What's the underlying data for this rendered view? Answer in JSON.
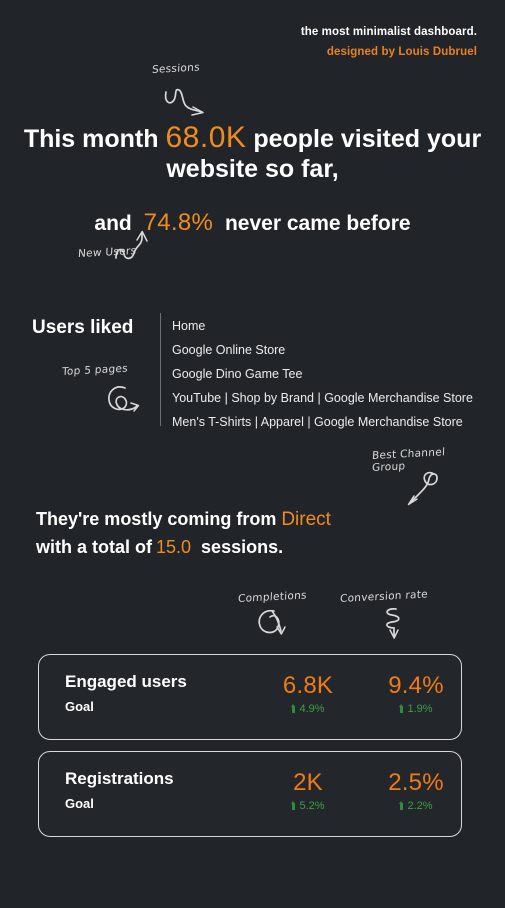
{
  "header": {
    "title": "the most minimalist dashboard.",
    "designer": "designed by Louis Dubruel",
    "accent_color": "#e8821e"
  },
  "theme": {
    "background": "#212529",
    "text": "#ffffff",
    "accent_orange": "#f08c1e",
    "metric_orange": "#ef7b14",
    "positive_green": "#3d9e46",
    "divider": "#6d7074"
  },
  "annotations": {
    "sessions": "Sessions",
    "new_users": "New Users",
    "top_pages": "Top 5 pages",
    "best_channel_group_line1": "Best Channel",
    "best_channel_group_line2": "Group",
    "completions": "Completions",
    "conversion_rate": "Conversion rate"
  },
  "headline": {
    "prefix": "This month",
    "sessions_value": "68.0K",
    "suffix": "people visited your website so far,"
  },
  "headline2": {
    "prefix": "and",
    "new_users_value": "74.8%",
    "suffix": "never came before"
  },
  "users_liked": {
    "title": "Users liked",
    "pages": [
      "Home",
      "Google Online Store",
      "Google Dino Game Tee",
      "YouTube | Shop by Brand | Google Merchandise Store",
      "Men's T-Shirts | Apparel | Google Merchandise Store"
    ]
  },
  "channel": {
    "line1_prefix": "They're mostly coming from",
    "channel_name": "Direct",
    "line2_prefix": "with a total of",
    "sessions_total": "15.0",
    "line2_suffix": "sessions."
  },
  "cards": {
    "column_headers": [
      "Completions",
      "Conversion rate"
    ],
    "items": [
      {
        "label": "Engaged users",
        "sublabel": "Goal",
        "completions": {
          "value": "6.8K",
          "delta": "4.9%",
          "direction": "up"
        },
        "conversion": {
          "value": "9.4%",
          "delta": "1.9%",
          "direction": "up"
        }
      },
      {
        "label": "Registrations",
        "sublabel": "Goal",
        "completions": {
          "value": "2K",
          "delta": "5.2%",
          "direction": "up"
        },
        "conversion": {
          "value": "2.5%",
          "delta": "2.2%",
          "direction": "up"
        }
      }
    ]
  },
  "chart_data": {
    "type": "table",
    "title": "the most minimalist dashboard.",
    "kpis": [
      {
        "name": "Sessions",
        "value": 68000,
        "display": "68.0K"
      },
      {
        "name": "New Users",
        "value": 74.8,
        "display": "74.8%"
      },
      {
        "name": "Best Channel Group",
        "value": 15.0,
        "display": "15.0",
        "label": "Direct"
      }
    ],
    "top_pages": [
      "Home",
      "Google Online Store",
      "Google Dino Game Tee",
      "YouTube | Shop by Brand | Google Merchandise Store",
      "Men's T-Shirts | Apparel | Google Merchandise Store"
    ],
    "categories": [
      "Engaged users",
      "Registrations"
    ],
    "series": [
      {
        "name": "Completions",
        "values": [
          6800,
          2000
        ],
        "displays": [
          "6.8K",
          "2K"
        ],
        "deltas": [
          4.9,
          5.2
        ]
      },
      {
        "name": "Conversion rate",
        "values": [
          9.4,
          2.5
        ],
        "displays": [
          "9.4%",
          "2.5%"
        ],
        "deltas": [
          1.9,
          2.2
        ]
      }
    ]
  }
}
